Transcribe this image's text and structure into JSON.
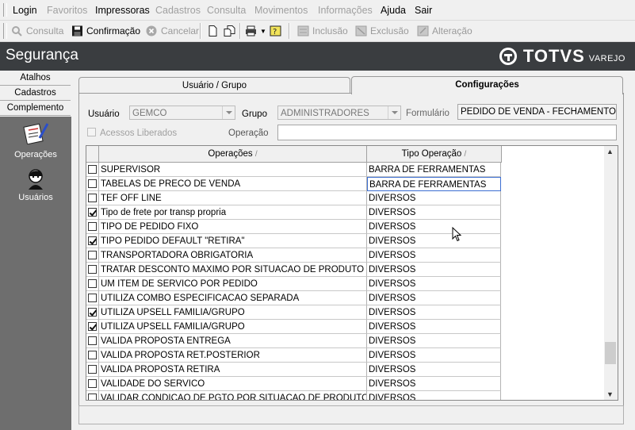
{
  "menu": [
    {
      "label": "Login",
      "enabled": true
    },
    {
      "label": "Favoritos",
      "enabled": false
    },
    {
      "label": "Impressoras",
      "enabled": true
    },
    {
      "label": "Cadastros",
      "enabled": false
    },
    {
      "label": "Consulta",
      "enabled": false
    },
    {
      "label": "Movimentos",
      "enabled": false
    },
    {
      "label": "Informações",
      "enabled": false
    },
    {
      "label": "Ajuda",
      "enabled": true
    },
    {
      "label": "Sair",
      "enabled": true
    }
  ],
  "toolbar": {
    "consulta": "Consulta",
    "confirmacao": "Confirmação",
    "cancelar": "Cancelar",
    "inclusao": "Inclusão",
    "exclusao": "Exclusão",
    "alteracao": "Alteração"
  },
  "header": {
    "title": "Segurança",
    "brand": "TOTVS",
    "brand_sub": "VAREJO"
  },
  "leftnav": {
    "tabs": [
      "Atalhos",
      "Cadastros",
      "Complemento"
    ],
    "buttons": [
      "Operações",
      "Usuários"
    ]
  },
  "tabs": [
    "Usuário  / Grupo",
    "Configurações"
  ],
  "form": {
    "usuario_label": "Usuário",
    "usuario_value": "GEMCO",
    "grupo_label": "Grupo",
    "grupo_value": "ADMINISTRADORES",
    "formulario_label": "Formulário",
    "formulario_value": "PEDIDO DE VENDA - FECHAMENTO",
    "acessos_label": "Acessos Liberados",
    "operacao_label": "Operação",
    "operacao_value": ""
  },
  "grid": {
    "columns": [
      "Operações",
      "Tipo Operação"
    ],
    "rows": [
      {
        "checked": false,
        "op": "SUPERVISOR",
        "tipo": "BARRA DE FERRAMENTAS"
      },
      {
        "checked": false,
        "op": "TABELAS DE PRECO DE VENDA",
        "tipo": "BARRA DE FERRAMENTAS",
        "selected": true
      },
      {
        "checked": false,
        "op": "TEF OFF LINE",
        "tipo": "DIVERSOS"
      },
      {
        "checked": true,
        "op": "Tipo de frete por transp propria",
        "tipo": "DIVERSOS"
      },
      {
        "checked": false,
        "op": "TIPO DE PEDIDO FIXO",
        "tipo": "DIVERSOS"
      },
      {
        "checked": true,
        "op": "TIPO PEDIDO DEFAULT \"RETIRA\"",
        "tipo": "DIVERSOS"
      },
      {
        "checked": false,
        "op": "TRANSPORTADORA OBRIGATORIA",
        "tipo": "DIVERSOS"
      },
      {
        "checked": false,
        "op": "TRATAR DESCONTO MAXIMO POR SITUACAO DE PRODUTO",
        "tipo": "DIVERSOS"
      },
      {
        "checked": false,
        "op": "UM ITEM DE SERVICO POR PEDIDO",
        "tipo": "DIVERSOS"
      },
      {
        "checked": false,
        "op": "UTILIZA COMBO ESPECIFICACAO SEPARADA",
        "tipo": "DIVERSOS"
      },
      {
        "checked": true,
        "op": "UTILIZA UPSELL FAMILIA/GRUPO",
        "tipo": "DIVERSOS"
      },
      {
        "checked": true,
        "op": "UTILIZA UPSELL FAMILIA/GRUPO",
        "tipo": "DIVERSOS"
      },
      {
        "checked": false,
        "op": "VALIDA PROPOSTA ENTREGA",
        "tipo": "DIVERSOS"
      },
      {
        "checked": false,
        "op": "VALIDA PROPOSTA RET.POSTERIOR",
        "tipo": "DIVERSOS"
      },
      {
        "checked": false,
        "op": "VALIDA PROPOSTA RETIRA",
        "tipo": "DIVERSOS"
      },
      {
        "checked": false,
        "op": "VALIDADE DO SERVICO",
        "tipo": "DIVERSOS"
      },
      {
        "checked": false,
        "op": "VALIDAR CONDICAO DE PGTO POR SITUACAO DE PRODUTO",
        "tipo": "DIVERSOS"
      }
    ]
  }
}
